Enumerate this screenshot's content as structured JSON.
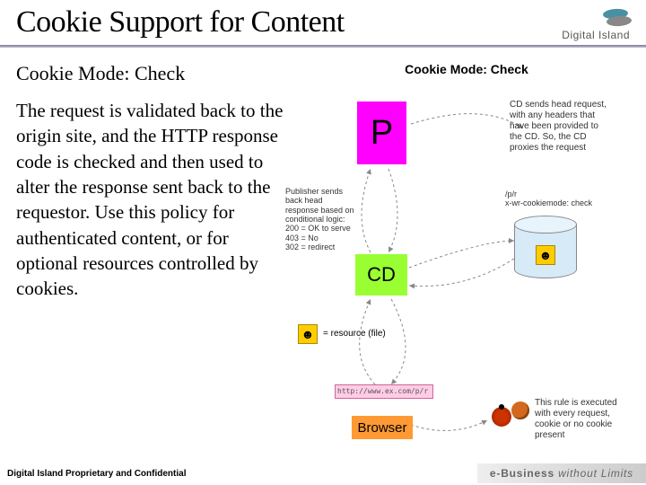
{
  "header": {
    "title": "Cookie Support for Content",
    "logo_text": "Digital Island"
  },
  "left_panel": {
    "subtitle": "Cookie Mode: Check",
    "body": "The request is validated back to the origin site, and the HTTP response code is checked and then used to alter the response sent back to the requestor. Use this policy for authenticated content, or for optional resources controlled by cookies."
  },
  "diagram": {
    "title": "Cookie Mode: Check",
    "nodes": {
      "publisher": "P",
      "cd": "CD",
      "browser": "Browser"
    },
    "top_note": "CD sends head request, with any headers that have been provided to the CD. So, the CD proxies the request",
    "path_label": "/p/r\nx-wr-cookiemode: check",
    "publisher_response": "Publisher sends back head response based on conditional logic:\n200 = OK to serve\n403 = No\n302 = redirect",
    "legend": "= resource (file)",
    "url_bar": "http://www.ex.com/p/r",
    "rule_note": "This rule is executed with every request, cookie or no cookie present"
  },
  "footer": {
    "left": "Digital Island Proprietary and Confidential",
    "right_prefix": "e-Business ",
    "right_suffix": "without Limits"
  }
}
